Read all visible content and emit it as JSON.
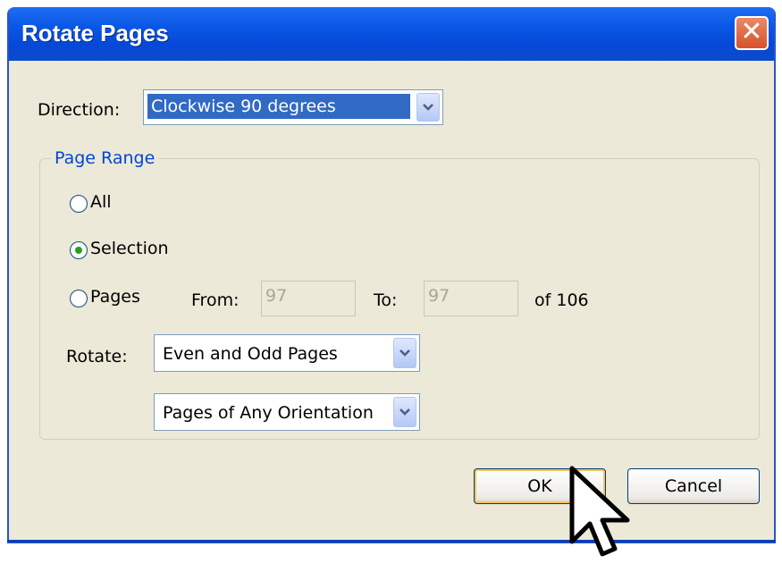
{
  "window": {
    "title": "Rotate Pages",
    "close_glyph": "✕"
  },
  "direction": {
    "label": "Direction:",
    "value": "Clockwise 90 degrees"
  },
  "page_range": {
    "legend": "Page Range",
    "options": [
      {
        "label": "All",
        "selected": false
      },
      {
        "label": "Selection",
        "selected": true
      },
      {
        "label": "Pages",
        "selected": false
      }
    ],
    "from_label": "From:",
    "from_value": "97",
    "to_label": "To:",
    "to_value": "97",
    "of_text": "of 106",
    "rotate_label": "Rotate:",
    "rotate_value": "Even and Odd Pages",
    "orientation_value": "Pages of Any Orientation"
  },
  "buttons": {
    "ok": "OK",
    "cancel": "Cancel"
  },
  "colors": {
    "title_bar": "#0a58e6",
    "selection": "#316ac5",
    "legend": "#0046d5",
    "radio_dot": "#21a121"
  }
}
